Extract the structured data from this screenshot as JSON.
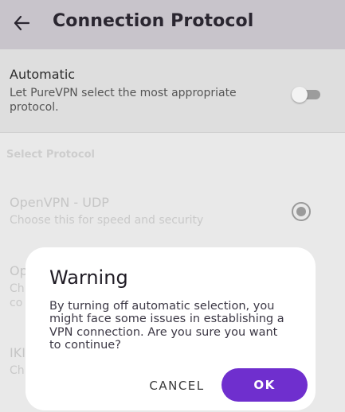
{
  "header": {
    "back_icon": "arrow-left-icon",
    "title": "Connection Protocol"
  },
  "automatic": {
    "title": "Automatic",
    "description": "Let PureVPN select the most appropriate protocol.",
    "toggle_on": false
  },
  "section": {
    "label": "Select Protocol"
  },
  "protocols": [
    {
      "name": "OpenVPN - UDP",
      "description": "Choose this for speed and security",
      "selected": true
    },
    {
      "name": "Op",
      "description": "Ch\nco",
      "selected": false
    },
    {
      "name": "IKI",
      "description": "Ch",
      "selected": false
    }
  ],
  "dialog": {
    "title": "Warning",
    "message": "By turning off automatic selection, you might face some issues in establishing a VPN connection. Are you sure you want to continue?",
    "cancel_label": "CANCEL",
    "ok_label": "OK"
  },
  "colors": {
    "accent": "#6f2fce",
    "appbar": "#c8c4cb",
    "scrim_background": "#e9e9e9"
  }
}
